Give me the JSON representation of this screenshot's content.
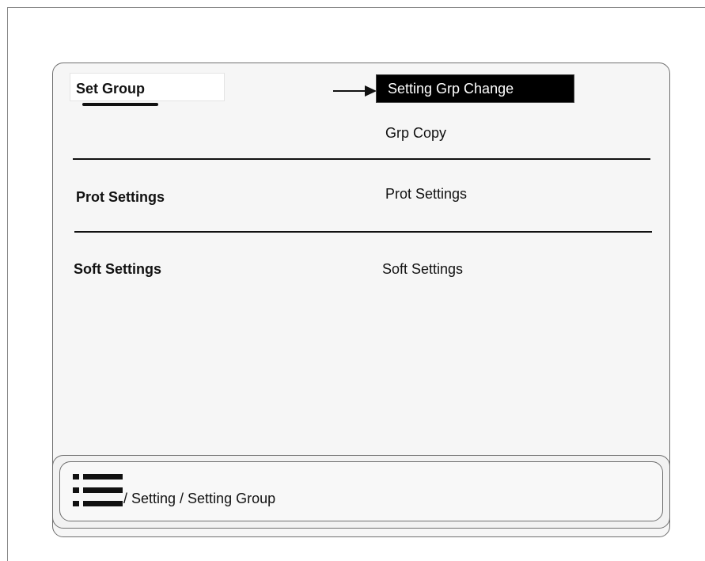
{
  "left_column": {
    "set_group": "Set Group",
    "prot_settings": "Prot Settings",
    "soft_settings": "Soft Settings"
  },
  "right_column": {
    "setting_grp_change": "Setting Grp Change",
    "grp_copy": "Grp Copy",
    "prot_settings": "Prot Settings",
    "soft_settings": "Soft Settings"
  },
  "breadcrumb": {
    "path": "/ Setting / Setting Group"
  },
  "icons": {
    "menu": "menu-list-icon",
    "pointer": "arrow-right-icon"
  },
  "colors": {
    "highlight_background": "#000000",
    "highlight_text": "#ffffff",
    "panel_background": "#f6f6f6"
  }
}
